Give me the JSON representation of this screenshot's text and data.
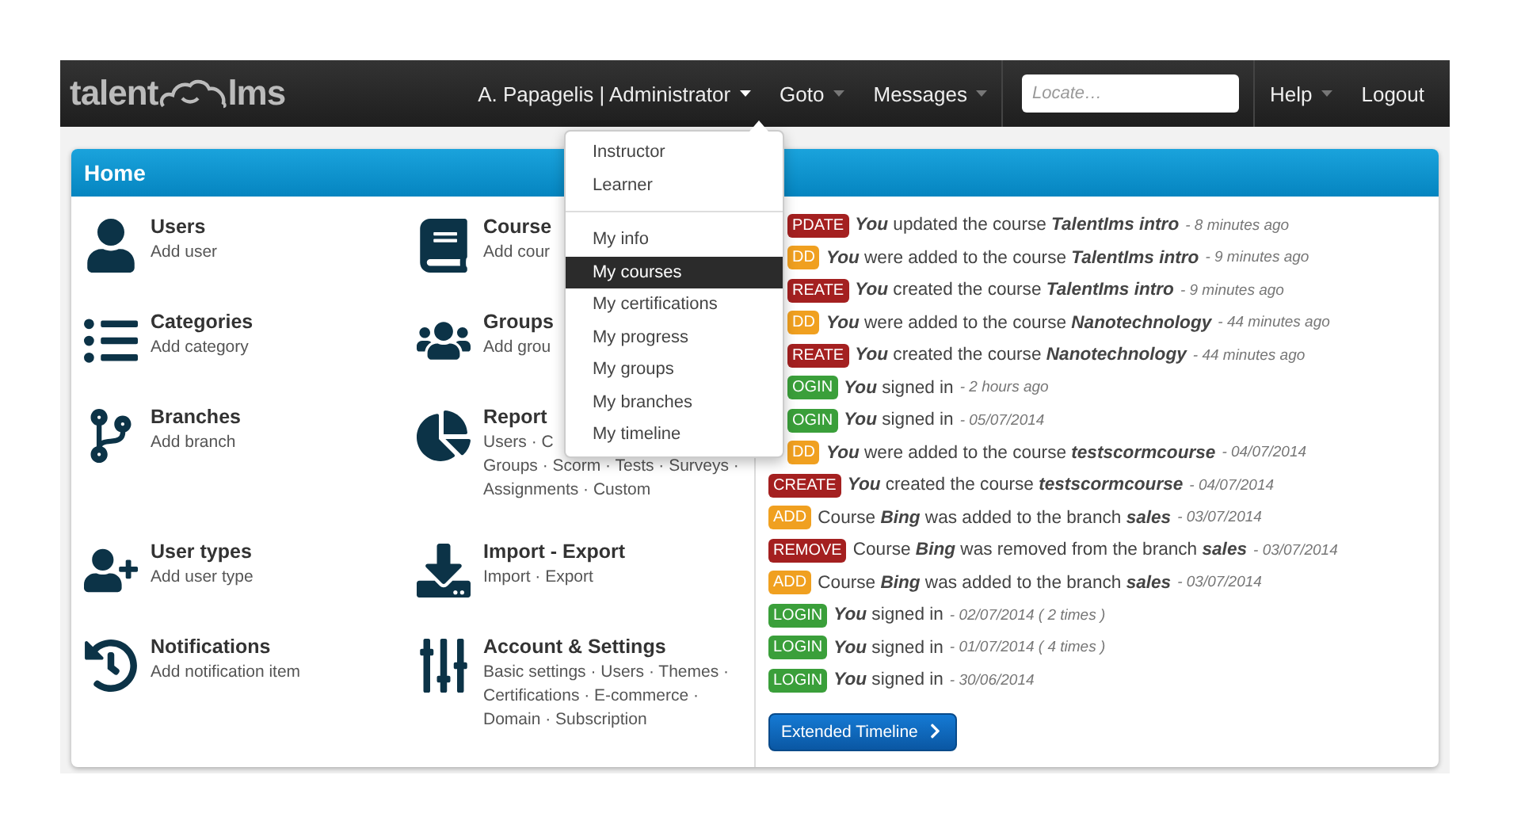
{
  "header": {
    "logo_left": "talent",
    "logo_right": "lms",
    "user": "A. Papagelis | Administrator",
    "nav": [
      "Goto",
      "Messages"
    ],
    "search": {
      "placeholder": "Locate…"
    },
    "help": "Help",
    "logout": "Logout"
  },
  "panel": {
    "title": "Home"
  },
  "sections": [
    {
      "title": "Users",
      "lines": [
        "Add user"
      ]
    },
    {
      "title": "Course",
      "lines": [
        "Add cour"
      ]
    },
    {
      "title": "Categories",
      "lines": [
        "Add category"
      ]
    },
    {
      "title": "Groups",
      "lines": [
        "Add grou"
      ]
    },
    {
      "title": "Branches",
      "lines": [
        "Add branch"
      ]
    },
    {
      "title": "Report",
      "lines": [
        "Users · C",
        "Groups · Scorm · Tests · Surveys ·",
        "Assignments · Custom"
      ]
    },
    {
      "title": "User types",
      "lines": [
        "Add user type"
      ]
    },
    {
      "title": "Import - Export",
      "lines": [
        "Import · Export"
      ]
    },
    {
      "title": "Notifications",
      "lines": [
        "Add notification item"
      ]
    },
    {
      "title": "Account & Settings",
      "lines": [
        "Basic settings · Users · Themes ·",
        "Certifications · E-commerce ·",
        "Domain · Subscription"
      ]
    }
  ],
  "dropdown": {
    "groups": [
      [
        {
          "label": "Instructor",
          "selected": false
        },
        {
          "label": "Learner",
          "selected": false
        }
      ],
      [
        {
          "label": "My info",
          "selected": false
        },
        {
          "label": "My courses",
          "selected": true
        },
        {
          "label": "My certifications",
          "selected": false
        },
        {
          "label": "My progress",
          "selected": false
        },
        {
          "label": "My groups",
          "selected": false
        },
        {
          "label": "My branches",
          "selected": false
        },
        {
          "label": "My timeline",
          "selected": false
        }
      ]
    ]
  },
  "timeline": [
    {
      "badge": "PDATE",
      "kind": "update",
      "clipped": true,
      "text": "*You* updated the course *TalentIms intro*",
      "time": "- 8 minutes ago"
    },
    {
      "badge": "DD",
      "kind": "add",
      "clipped": true,
      "text": "*You* were added to the course *TalentIms intro*",
      "time": "- 9 minutes ago"
    },
    {
      "badge": "REATE",
      "kind": "create",
      "clipped": true,
      "text": "*You* created the course *TalentIms intro*",
      "time": "- 9 minutes ago"
    },
    {
      "badge": "DD",
      "kind": "add",
      "clipped": true,
      "text": "*You* were added to the course *Nanotechnology*",
      "time": "- 44 minutes ago"
    },
    {
      "badge": "REATE",
      "kind": "create",
      "clipped": true,
      "text": "*You* created the course *Nanotechnology*",
      "time": "- 44 minutes ago"
    },
    {
      "badge": "OGIN",
      "kind": "login",
      "clipped": true,
      "text": "*You* signed in",
      "time": "- 2 hours ago"
    },
    {
      "badge": "OGIN",
      "kind": "login",
      "clipped": true,
      "text": "*You* signed in",
      "time": "- 05/07/2014"
    },
    {
      "badge": "DD",
      "kind": "add",
      "clipped": true,
      "text": "*You* were added to the course *testscormcourse*",
      "time": "- 04/07/2014"
    },
    {
      "badge": "CREATE",
      "kind": "create",
      "clipped": false,
      "text": "*You* created the course *testscormcourse*",
      "time": "- 04/07/2014"
    },
    {
      "badge": "ADD",
      "kind": "add",
      "clipped": false,
      "text": "Course *Bing* was added to the branch *sales*",
      "time": "- 03/07/2014"
    },
    {
      "badge": "REMOVE",
      "kind": "remove",
      "clipped": false,
      "text": "Course *Bing* was removed from the branch *sales*",
      "time": "- 03/07/2014"
    },
    {
      "badge": "ADD",
      "kind": "add",
      "clipped": false,
      "text": "Course *Bing* was added to the branch *sales*",
      "time": "- 03/07/2014"
    },
    {
      "badge": "LOGIN",
      "kind": "login",
      "clipped": false,
      "text": "*You* signed in",
      "time": "- 02/07/2014 ( 2 times )"
    },
    {
      "badge": "LOGIN",
      "kind": "login",
      "clipped": false,
      "text": "*You* signed in",
      "time": "- 01/07/2014 ( 4 times )"
    },
    {
      "badge": "LOGIN",
      "kind": "login",
      "clipped": false,
      "text": "*You* signed in",
      "time": "- 30/06/2014"
    }
  ],
  "timeline_button": "Extended Timeline"
}
